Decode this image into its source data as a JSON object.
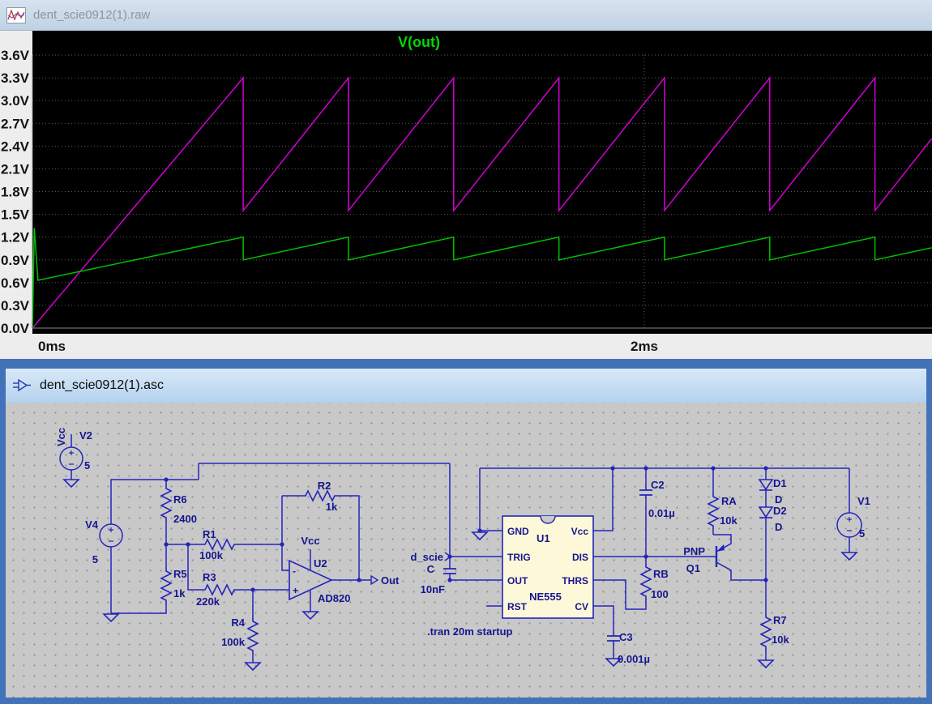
{
  "waveform_window": {
    "title": "dent_scie0912(1).raw"
  },
  "schematic_window": {
    "title": "dent_scie0912(1).asc",
    "directive": ".tran 20m startup",
    "net_labels": {
      "vcc_v2": "Vcc",
      "vcc_opamp": "Vcc",
      "out": "Out",
      "d_scie": "d_scie"
    },
    "components": {
      "V2": {
        "ref": "V2",
        "value": "5"
      },
      "V4": {
        "ref": "V4",
        "value": "5"
      },
      "V1": {
        "ref": "V1",
        "value": "5"
      },
      "R1": {
        "ref": "R1",
        "value": "100k"
      },
      "R2": {
        "ref": "R2",
        "value": "1k"
      },
      "R3": {
        "ref": "R3",
        "value": "220k"
      },
      "R4": {
        "ref": "R4",
        "value": "100k"
      },
      "R5": {
        "ref": "R5",
        "value": "1k"
      },
      "R6": {
        "ref": "R6",
        "value": "2400"
      },
      "R7": {
        "ref": "R7",
        "value": "10k"
      },
      "RA": {
        "ref": "RA",
        "value": "10k"
      },
      "RB": {
        "ref": "RB",
        "value": "100"
      },
      "C1": {
        "ref": "C",
        "value": "10nF"
      },
      "C2": {
        "ref": "C2",
        "value": "0.01µ"
      },
      "C3": {
        "ref": "C3",
        "value": "0.001µ"
      },
      "D1": {
        "ref": "D1",
        "value": "D"
      },
      "D2": {
        "ref": "D2",
        "value": "D"
      },
      "Q1": {
        "ref": "Q1",
        "value": "PNP"
      },
      "U1": {
        "ref": "U1",
        "value": "NE555"
      },
      "U2": {
        "ref": "U2",
        "value": "AD820"
      }
    },
    "u1_pins": {
      "gnd": "GND",
      "trig": "TRIG",
      "out": "OUT",
      "rst": "RST",
      "vcc": "Vcc",
      "dis": "DIS",
      "thrs": "THRS",
      "cv": "CV"
    },
    "opamp_marks": {
      "inv": "-",
      "noninv": "+"
    }
  },
  "chart_data": {
    "type": "line",
    "title": "V(out)",
    "title_color": "#00d800",
    "xlim": [
      0,
      2.94
    ],
    "ylim": [
      0,
      3.6
    ],
    "y_tick_step": 0.3,
    "y_unit": "V",
    "x_ticks": [
      {
        "value": 0,
        "label": "0ms"
      },
      {
        "value": 2,
        "label": "2ms"
      }
    ],
    "grid": true,
    "legend_position": "top",
    "series": [
      {
        "name": "",
        "color": "#d200d2",
        "points": [
          [
            0,
            0
          ],
          [
            0.689,
            3.3
          ],
          [
            0.689,
            1.55
          ],
          [
            1.033,
            3.3
          ],
          [
            1.033,
            1.55
          ],
          [
            1.377,
            3.3
          ],
          [
            1.377,
            1.55
          ],
          [
            1.721,
            3.3
          ],
          [
            1.721,
            1.55
          ],
          [
            2.066,
            3.3
          ],
          [
            2.066,
            1.55
          ],
          [
            2.41,
            3.3
          ],
          [
            2.41,
            1.55
          ],
          [
            2.754,
            3.3
          ],
          [
            2.754,
            1.55
          ],
          [
            2.94,
            2.5
          ]
        ]
      },
      {
        "name": "V(out)",
        "color": "#00c000",
        "points": [
          [
            0,
            0
          ],
          [
            0.006,
            1.32
          ],
          [
            0.018,
            0.63
          ],
          [
            0.689,
            1.2
          ],
          [
            0.689,
            0.9
          ],
          [
            1.033,
            1.2
          ],
          [
            1.033,
            0.9
          ],
          [
            1.377,
            1.2
          ],
          [
            1.377,
            0.9
          ],
          [
            1.721,
            1.2
          ],
          [
            1.721,
            0.9
          ],
          [
            2.066,
            1.2
          ],
          [
            2.066,
            0.9
          ],
          [
            2.41,
            1.2
          ],
          [
            2.41,
            0.9
          ],
          [
            2.754,
            1.2
          ],
          [
            2.754,
            0.9
          ],
          [
            2.94,
            1.06
          ]
        ]
      }
    ]
  }
}
